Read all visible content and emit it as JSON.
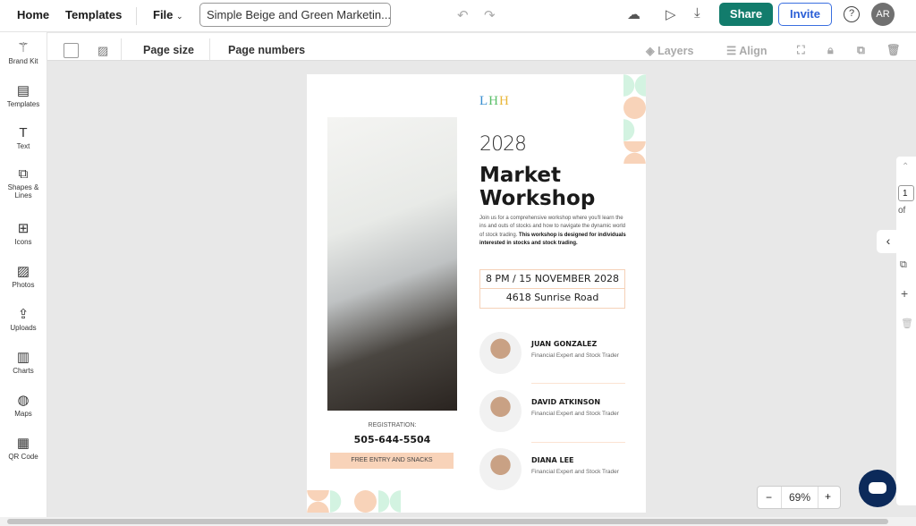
{
  "topbar": {
    "home": "Home",
    "templates": "Templates",
    "file": "File",
    "doc_title": "Simple Beige and Green Marketin...",
    "share": "Share",
    "invite": "Invite",
    "avatar": "AR"
  },
  "sidebar": {
    "items": [
      {
        "label": "Brand Kit",
        "icon": "magic-wand-icon"
      },
      {
        "label": "Templates",
        "icon": "templates-icon"
      },
      {
        "label": "Text",
        "icon": "text-icon"
      },
      {
        "label": "Shapes & Lines",
        "icon": "shapes-icon"
      },
      {
        "label": "Icons",
        "icon": "icons-icon"
      },
      {
        "label": "Photos",
        "icon": "photo-icon"
      },
      {
        "label": "Uploads",
        "icon": "upload-icon"
      },
      {
        "label": "Charts",
        "icon": "chart-icon"
      },
      {
        "label": "Maps",
        "icon": "globe-icon"
      },
      {
        "label": "QR Code",
        "icon": "qr-icon"
      }
    ]
  },
  "toolbar": {
    "page_size": "Page size",
    "page_numbers": "Page numbers",
    "layers": "Layers",
    "align": "Align"
  },
  "poster": {
    "logo": "LHH",
    "year": "2028",
    "title_line1": "Market",
    "title_line2": "Workshop",
    "intro": "Join us for a comprehensive workshop where you'll learn the ins and outs of stocks and how to navigate the dynamic world of stock trading. ",
    "intro_bold": "This workshop is designed for individuals interested in stocks and stock trading.",
    "datetime": "8 PM / 15 NOVEMBER 2028",
    "address": "4618 Sunrise Road",
    "registration_label": "REGISTRATION:",
    "phone": "505-644-5504",
    "free_entry": "FREE ENTRY AND SNACKS",
    "speakers": [
      {
        "name": "JUAN GONZALEZ",
        "role": "Financial Expert and Stock Trader"
      },
      {
        "name": "DAVID ATKINSON",
        "role": "Financial Expert and Stock Trader"
      },
      {
        "name": "DIANA LEE",
        "role": "Financial Expert and Stock Trader"
      }
    ],
    "colors": {
      "peach": "#f8d3b9",
      "mint": "#d3f3e1"
    }
  },
  "right_panel": {
    "page_current": "1",
    "page_of": "of"
  },
  "zoom": {
    "minus": "−",
    "value": "69%",
    "plus": "+"
  },
  "colors": {
    "share": "#127c6c",
    "invite": "#2a5ed6"
  }
}
